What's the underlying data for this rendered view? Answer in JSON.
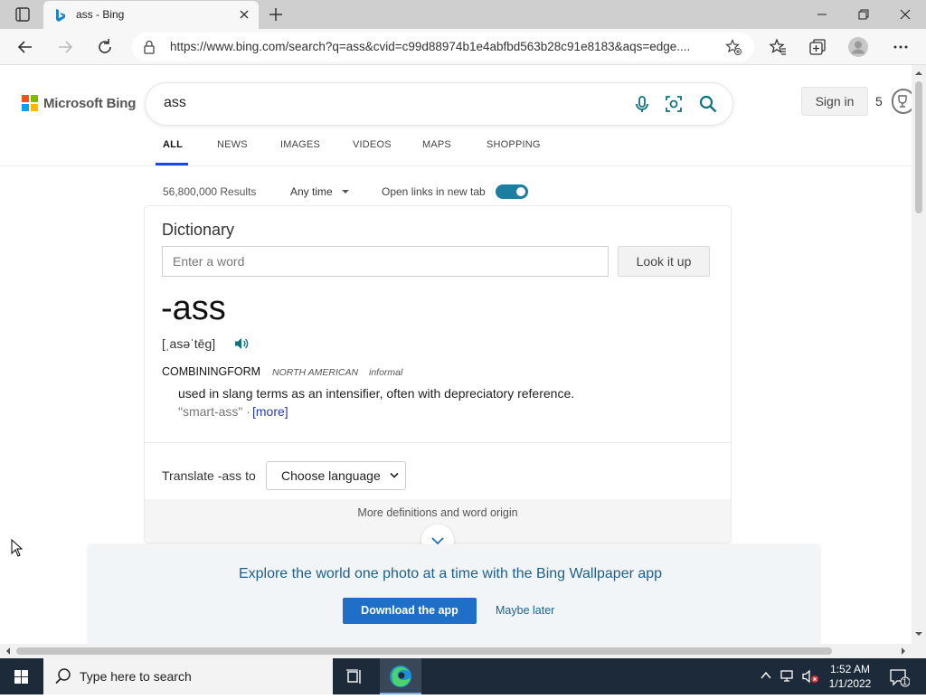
{
  "browser": {
    "tab_title": "ass - Bing",
    "url": "https://www.bing.com/search?q=ass&cvid=c99d88974b1e4abfbd563b28c91e8183&aqs=edge...."
  },
  "bing": {
    "brand": "Microsoft Bing",
    "query": "ass",
    "sign_in": "Sign in",
    "rewards_count": "5",
    "tabs": [
      "ALL",
      "NEWS",
      "IMAGES",
      "VIDEOS",
      "MAPS",
      "SHOPPING"
    ],
    "result_count": "56,800,000 Results",
    "time_filter": "Any time",
    "new_tab_label": "Open links in new tab",
    "new_tab_toggle_on": true
  },
  "dictionary": {
    "header": "Dictionary",
    "input_placeholder": "Enter a word",
    "lookup_button": "Look it up",
    "headword": "-ass",
    "pronunciation": "[ˌasəˈtēg]",
    "part_of_speech": "COMBININGFORM",
    "region": "NORTH AMERICAN",
    "register": "informal",
    "definition": "used in slang terms as an intensifier, often with depreciatory reference.",
    "example": "\"smart-ass\" ·",
    "more_link": "[more]",
    "translate_label": "Translate -ass to",
    "language_select": "Choose language",
    "more_definitions": "More definitions and word origin"
  },
  "promo": {
    "message": "Explore the world one photo at a time with the Bing Wallpaper app",
    "download": "Download the app",
    "later": "Maybe later"
  },
  "taskbar": {
    "search_placeholder": "Type here to search",
    "time": "1:52 AM",
    "date": "1/1/2022",
    "notification_count": "1"
  },
  "colors": {
    "accent_blue": "#174ae4",
    "toggle_teal": "#1a7fa0",
    "link_blue": "#2a3aa7",
    "button_blue": "#1f6fc9",
    "taskbar": "#1d2a3a"
  }
}
